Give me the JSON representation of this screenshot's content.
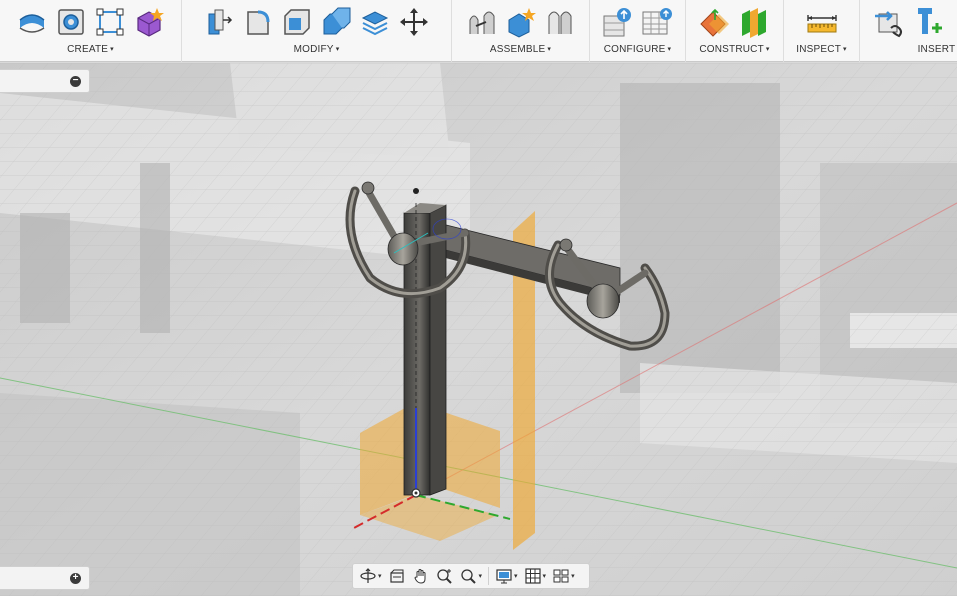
{
  "toolbar": {
    "groups": [
      {
        "label": "CREATE",
        "icons": [
          "extrude-icon",
          "hole-icon",
          "sketch-icon",
          "form-icon"
        ]
      },
      {
        "label": "MODIFY",
        "icons": [
          "press-pull-icon",
          "fillet-icon",
          "shell-icon",
          "combine-icon",
          "replace-face-icon",
          "move-icon"
        ]
      },
      {
        "label": "ASSEMBLE",
        "icons": [
          "joint-icon",
          "new-component-icon",
          "as-built-joint-icon"
        ]
      },
      {
        "label": "CONFIGURE",
        "icons": [
          "configure-icon",
          "table-icon"
        ]
      },
      {
        "label": "CONSTRUCT",
        "icons": [
          "offset-plane-icon",
          "midplane-icon"
        ]
      },
      {
        "label": "INSPECT",
        "icons": [
          "measure-icon"
        ]
      },
      {
        "label": "INSERT",
        "icons": [
          "insert-derive-icon",
          "insert-mcmaster-icon"
        ]
      }
    ],
    "caret": "▾"
  },
  "panels": {
    "browser_toggle": "−",
    "comments_toggle": "+"
  },
  "navbar": {
    "buttons": [
      "orbit-icon",
      "look-at-icon",
      "pan-icon",
      "zoom-icon",
      "fit-icon",
      "display-settings-icon",
      "grid-icon",
      "viewports-icon"
    ]
  },
  "colors": {
    "toolbar_bg": "#f7f7f7",
    "accent_blue": "#3c8fd6",
    "plane_orange": "#f0a830",
    "axis_red": "#d42b2b",
    "axis_green": "#2ea82e",
    "axis_blue": "#2b3fd4"
  }
}
